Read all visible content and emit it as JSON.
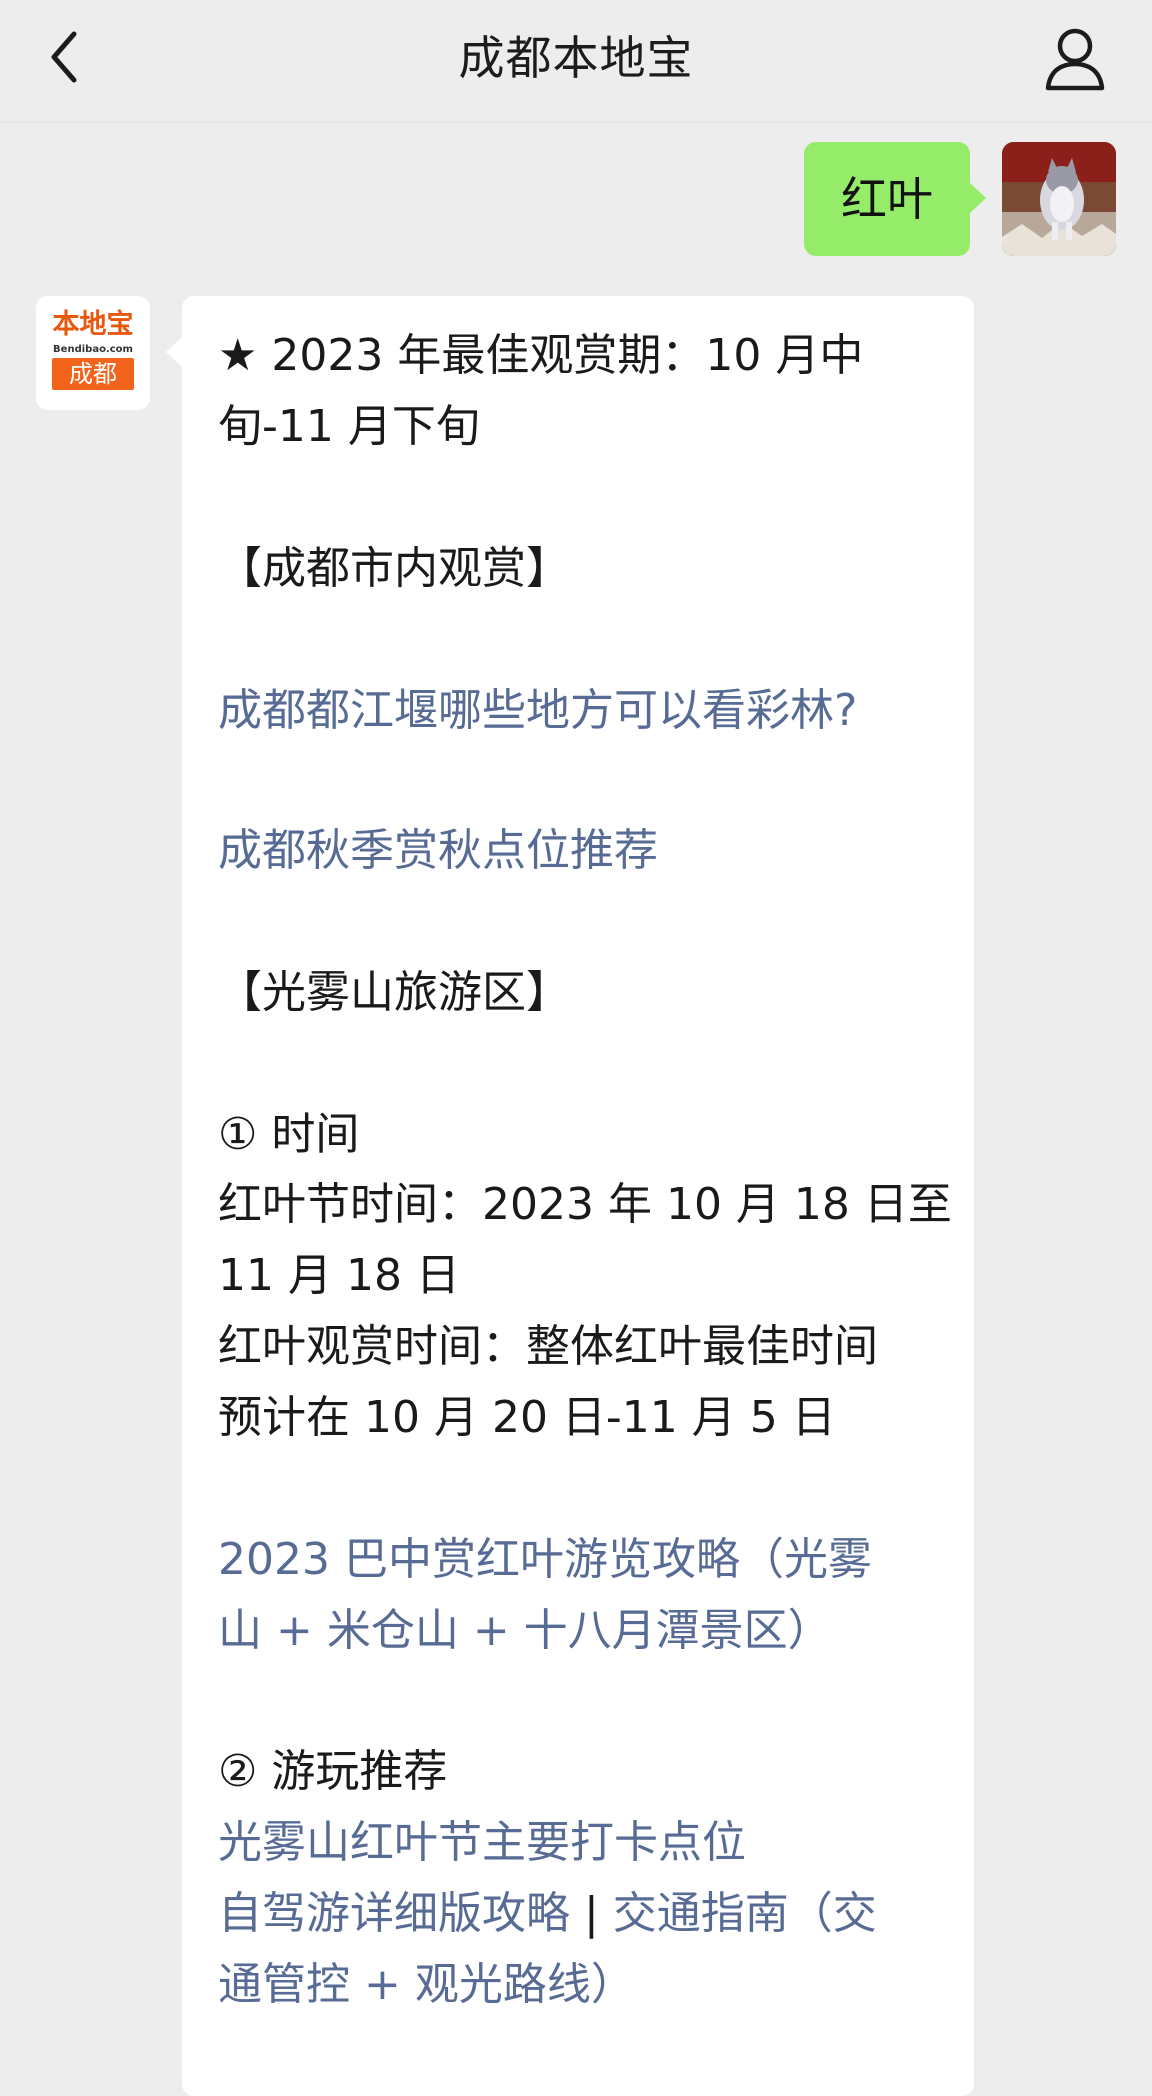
{
  "header": {
    "title": "成都本地宝",
    "back_icon": "chevron-left-icon",
    "profile_icon": "person-icon"
  },
  "sent": {
    "text": "红叶",
    "bubble_color": "#95ec69"
  },
  "bot": {
    "logo_top": "本地宝",
    "logo_domain": "Bendibao.com",
    "logo_city": "成都",
    "brand_color": "#f2641b"
  },
  "message": {
    "best_period_1": "★ 2023 年最佳观赏期：10 月中",
    "best_period_2": "旬-11 月下旬",
    "section_city": "【成都市内观赏】",
    "link_dujiangyan": "成都都江堰哪些地方可以看彩林?",
    "link_autumn_spots": "成都秋季赏秋点位推荐",
    "section_guangwu": "【光雾山旅游区】",
    "time_heading": "① 时间",
    "festival_1": "红叶节时间：2023 年 10 月 18 日至",
    "festival_2": "11 月 18 日",
    "viewing_1": "红叶观赏时间：整体红叶最佳时间",
    "viewing_2": "预计在 10 月 20 日-11 月 5 日",
    "link_bazhong_1": "2023 巴中赏红叶游览攻略（光雾",
    "link_bazhong_2": "山 + 米仓山 + 十八月潭景区）",
    "play_heading": "② 游玩推荐",
    "link_checkin": "光雾山红叶节主要打卡点位",
    "link_selfdrive": "自驾游详细版攻略",
    "separator": " | ",
    "link_traffic_1": "交通指南（交",
    "link_traffic_2": "通管控 + 观光路线）",
    "link_color": "#576b95"
  }
}
